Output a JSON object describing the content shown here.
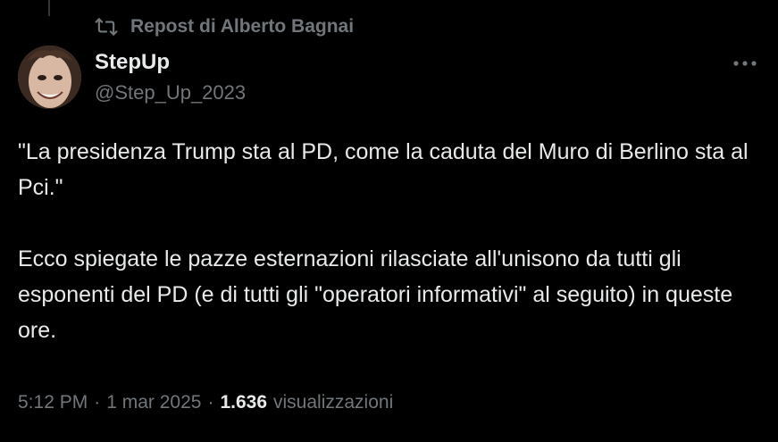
{
  "repost": {
    "label": "Repost di Alberto Bagnai",
    "icon": "repost-icon"
  },
  "author": {
    "display_name": "StepUp",
    "handle": "@Step_Up_2023"
  },
  "tweet": {
    "paragraphs": [
      "\"La presidenza Trump sta al PD, come la caduta del Muro di Berlino sta al Pci.\"",
      "Ecco spiegate le pazze esternazioni rilasciate all'unisono da tutti gli esponenti del PD (e di tutti gli \"operatori informativi\" al seguito) in queste ore."
    ]
  },
  "meta": {
    "time": "5:12 PM",
    "separator": "·",
    "date": "1 mar 2025",
    "views_count": "1.636",
    "views_label": "visualizzazioni"
  },
  "colors": {
    "background": "#000000",
    "primary_text": "#e7e9ea",
    "secondary_text": "#71767b"
  }
}
